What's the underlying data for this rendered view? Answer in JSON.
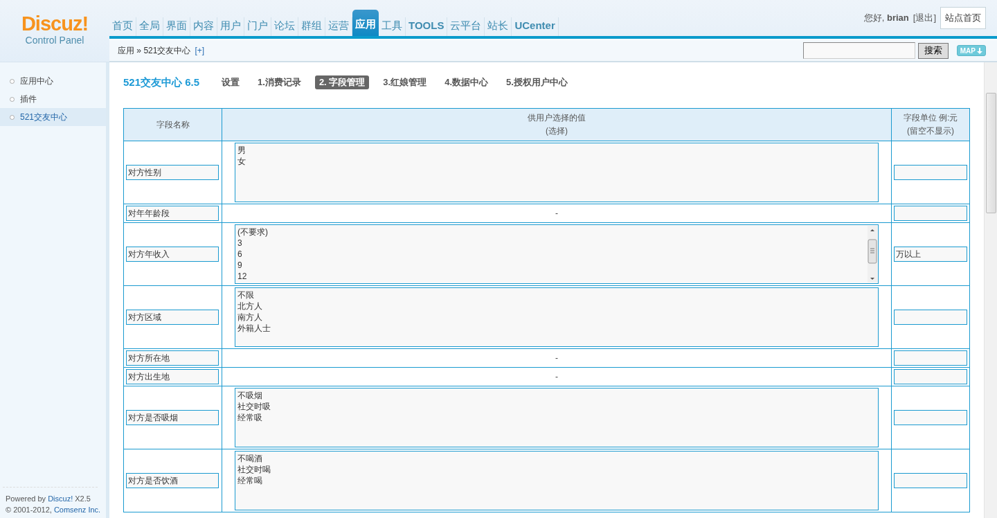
{
  "logo": {
    "name": "Discuz!",
    "subtitle": "Control Panel"
  },
  "nav": [
    {
      "label": "首页",
      "selected": false
    },
    {
      "label": "全局",
      "selected": false
    },
    {
      "label": "界面",
      "selected": false
    },
    {
      "label": "内容",
      "selected": false
    },
    {
      "label": "用户",
      "selected": false
    },
    {
      "label": "门户",
      "selected": false
    },
    {
      "label": "论坛",
      "selected": false
    },
    {
      "label": "群组",
      "selected": false
    },
    {
      "label": "运营",
      "selected": false
    },
    {
      "label": "应用",
      "selected": true
    },
    {
      "label": "工具",
      "selected": false
    },
    {
      "label": "TOOLS",
      "selected": false
    },
    {
      "label": "云平台",
      "selected": false
    },
    {
      "label": "站长",
      "selected": false
    },
    {
      "label": "UCenter",
      "selected": false
    }
  ],
  "user": {
    "greeting": "您好,",
    "name": "brian",
    "logout": "[退出]",
    "home_button": "站点首页"
  },
  "breadcrumb": {
    "root": "应用",
    "separator": "»",
    "current": "521交友中心",
    "add": "[+]"
  },
  "search": {
    "button": "搜索",
    "map_button": "MAP"
  },
  "sidebar": {
    "items": [
      {
        "label": "应用中心",
        "selected": false
      },
      {
        "label": "插件",
        "selected": false
      },
      {
        "label": "521交友中心",
        "selected": true
      }
    ],
    "footer": {
      "powered_prefix": "Powered by",
      "powered_link": "Discuz!",
      "version": "X2.5",
      "copyright_prefix": "© 2001-2012,",
      "copyright_link": "Comsenz Inc."
    }
  },
  "plugin": {
    "title": "521交友中心 6.5",
    "tabs": [
      {
        "label": "设置",
        "selected": false
      },
      {
        "label": "1.消费记录",
        "selected": false
      },
      {
        "label": "2. 字段管理",
        "selected": true
      },
      {
        "label": "3.红娘管理",
        "selected": false
      },
      {
        "label": "4.数据中心",
        "selected": false
      },
      {
        "label": "5.授权用户中心",
        "selected": false
      }
    ]
  },
  "table": {
    "columns": [
      {
        "lines": [
          "字段名称"
        ]
      },
      {
        "lines": [
          "供用户选择的值",
          "(选择)"
        ]
      },
      {
        "lines": [
          "字段单位 例:元",
          "(留空不显示)"
        ]
      }
    ],
    "rows": [
      {
        "name": "对方性别",
        "kind": "list",
        "options": [
          "男",
          "女"
        ],
        "scrollable": false,
        "unit": ""
      },
      {
        "name": "对年年龄段",
        "kind": "none",
        "dash": "-",
        "unit": ""
      },
      {
        "name": "对方年收入",
        "kind": "list",
        "options": [
          "(不要求)",
          "3",
          "6",
          "9",
          "12"
        ],
        "scrollable": true,
        "unit": "万以上"
      },
      {
        "name": "对方区域",
        "kind": "list",
        "options": [
          "不限",
          "北方人",
          "南方人",
          "外籍人士"
        ],
        "scrollable": false,
        "unit": ""
      },
      {
        "name": "对方所在地",
        "kind": "none",
        "dash": "-",
        "unit": ""
      },
      {
        "name": "对方出生地",
        "kind": "none",
        "dash": "-",
        "unit": ""
      },
      {
        "name": "对方是否吸烟",
        "kind": "list",
        "options": [
          "不吸烟",
          "社交时吸",
          "经常吸"
        ],
        "scrollable": false,
        "unit": ""
      },
      {
        "name": "对方是否饮酒",
        "kind": "list",
        "options": [
          "不喝酒",
          "社交时喝",
          "经常喝"
        ],
        "scrollable": false,
        "unit": ""
      }
    ]
  }
}
